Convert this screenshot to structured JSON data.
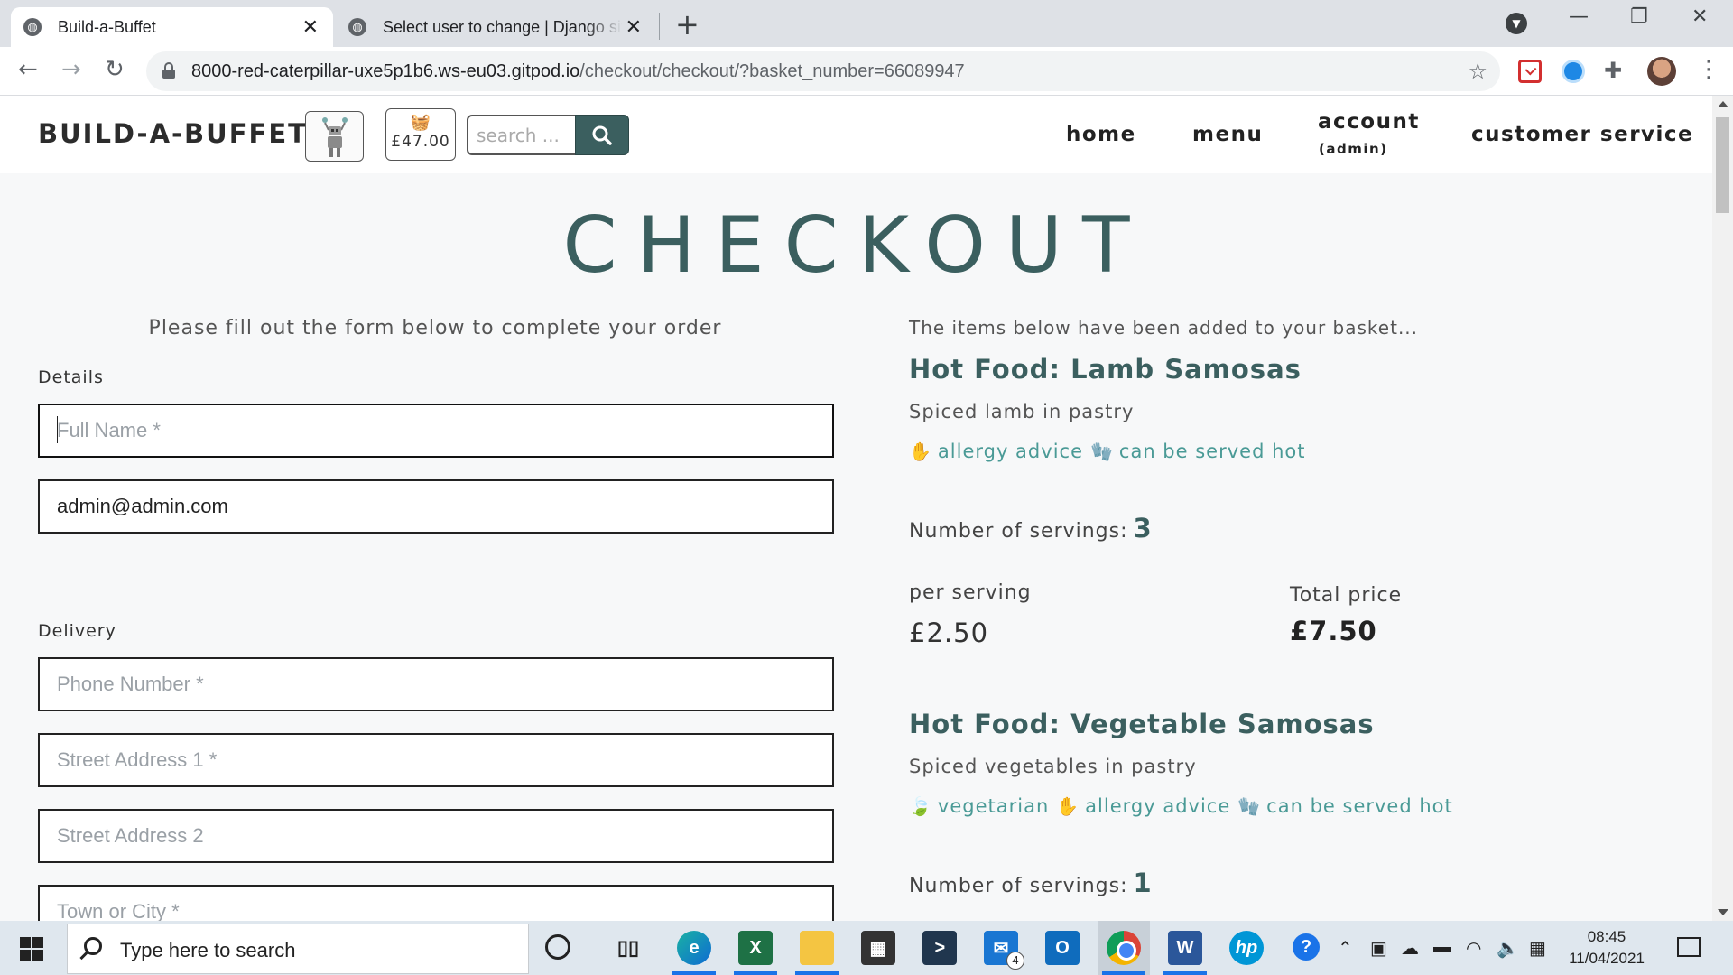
{
  "browser": {
    "tabs": [
      {
        "title": "Build-a-Buffet",
        "active": true
      },
      {
        "title": "Select user to change | Django site admin",
        "active": false
      }
    ],
    "new_tab_label": "+",
    "url_host": "8000-red-caterpillar-uxe5p1b6.ws-eu03.gitpod.io",
    "url_path": "/checkout/checkout/?basket_number=66089947"
  },
  "site": {
    "brand": "BUILD-A-BUFFET",
    "basket_total": "£47.00",
    "search_placeholder": "search ...",
    "nav": {
      "home": "home",
      "menu": "menu",
      "account": "account",
      "account_sub": "(admin)",
      "customer_service": "customer service"
    }
  },
  "checkout": {
    "title": "CHECKOUT",
    "form_intro": "Please fill out the form below to complete your order",
    "details_label": "Details",
    "delivery_label": "Delivery",
    "fields": {
      "full_name_placeholder": "Full Name *",
      "email_value": "admin@admin.com",
      "phone_placeholder": "Phone Number *",
      "street1_placeholder": "Street Address 1 *",
      "street2_placeholder": "Street Address 2",
      "town_placeholder": "Town or City *"
    },
    "basket_intro": "The items below have been added to your basket...",
    "items": [
      {
        "name": "Hot Food: Lamb Samosas",
        "description": "Spiced lamb in pastry",
        "tags": [
          {
            "icon": "hand-icon",
            "label": "allergy advice"
          },
          {
            "icon": "mitten-icon",
            "label": "can be served hot"
          }
        ],
        "servings_label": "Number of servings:",
        "servings": "3",
        "per_serving_label": "per serving",
        "per_serving": "£2.50",
        "total_label": "Total price",
        "total": "£7.50"
      },
      {
        "name": "Hot Food: Vegetable Samosas",
        "description": "Spiced vegetables in pastry",
        "tags": [
          {
            "icon": "leaf-icon",
            "label": "vegetarian"
          },
          {
            "icon": "hand-icon",
            "label": "allergy advice"
          },
          {
            "icon": "mitten-icon",
            "label": "can be served hot"
          }
        ],
        "servings_label": "Number of servings:",
        "servings": "1"
      }
    ]
  },
  "taskbar": {
    "search_text": "Type here to search",
    "mail_badge": "4",
    "time": "08:45",
    "date": "11/04/2021"
  },
  "colors": {
    "accent": "#3b5f5f",
    "tag": "#4a9a96"
  }
}
